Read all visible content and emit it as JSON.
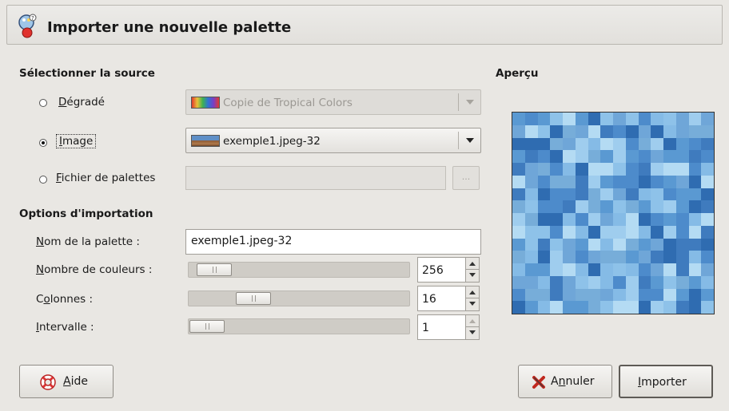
{
  "window": {
    "title": "Importer une nouvelle palette"
  },
  "source": {
    "section_label": "Sélectionner la source",
    "options": [
      {
        "label": "Dégradé",
        "mnemonic": "D",
        "checked": false,
        "value": "Copie de Tropical Colors",
        "enabled": false
      },
      {
        "label": "Image",
        "mnemonic": "I",
        "checked": true,
        "value": "exemple1.jpeg-32",
        "enabled": true
      },
      {
        "label": "Fichier de palettes",
        "mnemonic": "F",
        "checked": false,
        "value": "",
        "enabled": false,
        "browse_label": "..."
      }
    ]
  },
  "options": {
    "section_label": "Options d'importation",
    "palette_name": {
      "label": "Nom de la palette :",
      "value": "exemple1.jpeg-32"
    },
    "num_colors": {
      "label": "Nombre de couleurs :",
      "value": "256",
      "slider_fraction": 0.04
    },
    "columns": {
      "label": "Colonnes :",
      "value": "16",
      "slider_fraction": 0.25
    },
    "interval": {
      "label": "Intervalle :",
      "value": "1",
      "slider_fraction": 0.0
    }
  },
  "preview": {
    "label": "Aperçu"
  },
  "buttons": {
    "help": "Aide",
    "cancel": "Annuler",
    "import": "Importer"
  },
  "colors": {
    "palette": [
      "#6fa6d8",
      "#85bbe6",
      "#4d8bcb",
      "#9fcdee",
      "#3f7bbe",
      "#5a99d2",
      "#b4dbf3",
      "#77add9",
      "#2f6cb1",
      "#8ec2e9"
    ]
  }
}
